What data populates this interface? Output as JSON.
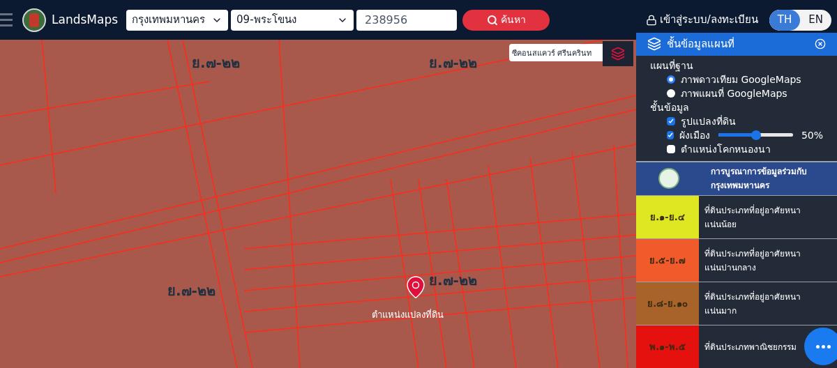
{
  "header": {
    "logo_text": "LandsMaps",
    "province": {
      "value": "กรุงเทพมหานคร"
    },
    "district": {
      "value": "09-พระโขนง"
    },
    "parcel_number": {
      "value": "238956"
    },
    "search_button": "ค้นหา",
    "login": "เข้าสู่ระบบ/ลงทะเบียน",
    "languages": [
      {
        "label": "TH",
        "selected": true
      },
      {
        "label": "EN",
        "selected": false
      }
    ]
  },
  "map": {
    "search_field": {
      "value": "ซีคอนสแควร์ ศรีนครินท"
    },
    "zone_labels": [
      "ย.๗-๒๒",
      "ย.๗-๒๒",
      "ย.๗-๒๒",
      "ย.๗-๒๒"
    ],
    "marker": {
      "label": "ตำแหน่งแปลงที่ดิน"
    }
  },
  "layers_panel": {
    "title": "ชั้นข้อมูลแผนที่",
    "base_map": {
      "heading": "แผนที่ฐาน",
      "options": [
        {
          "label": "ภาพดาวเทียม GoogleMaps",
          "selected": true
        },
        {
          "label": "ภาพแผนที่ GoogleMaps",
          "selected": false
        }
      ]
    },
    "data_layers": {
      "heading": "ชั้นข้อมูล",
      "items": [
        {
          "kind": "checkbox",
          "label": "รูปแปลงที่ดิน",
          "checked": true
        },
        {
          "kind": "slider",
          "label": "ผังเมือง",
          "checked": true,
          "level": 0.5,
          "reading": "50%"
        },
        {
          "kind": "checkbox",
          "label": "ตำแหน่งโคกหนองนา",
          "checked": false
        }
      ]
    },
    "partner_banner": [
      "การบูรณาการข้อมูลร่วมกับ",
      "กรุงเทพมหานคร"
    ],
    "legend": [
      {
        "code": "ย.๑-ย.๔",
        "description": "ที่ดินประเภทที่อยู่อาศัยหนาแน่นน้อย",
        "color": "#dfe622"
      },
      {
        "code": "ย.๕-ย.๗",
        "description": "ที่ดินประเภทที่อยู่อาศัยหนาแน่นปานกลาง",
        "color": "#f15a2b"
      },
      {
        "code": "ย.๘-ย.๑๐",
        "description": "ที่ดินประเภทที่อยู่อาศัยหนาแน่นมาก",
        "color": "#a8632b"
      },
      {
        "code": "พ.๑-พ.๕",
        "description": "ที่ดินประเภทพาณิชยกรรม",
        "color": "#e5110f"
      }
    ]
  }
}
